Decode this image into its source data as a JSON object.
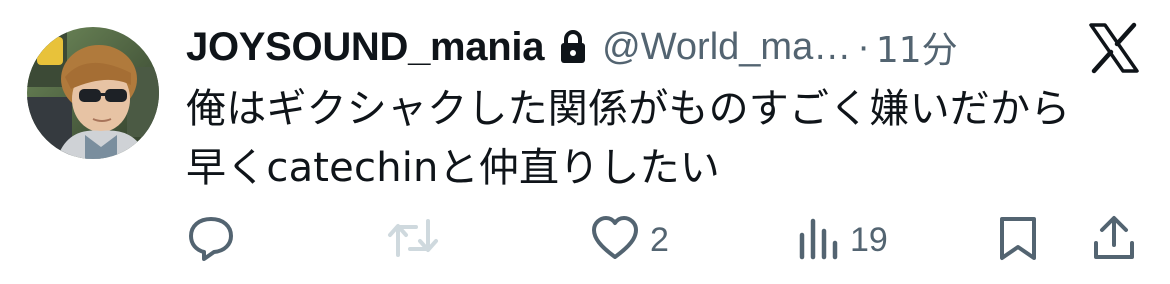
{
  "user": {
    "display_name": "JOYSOUND_mania",
    "handle": "@World_ma…",
    "separator": "·",
    "time": "11分"
  },
  "tweet": {
    "lines": [
      "俺はギクシャクした関係がものすごく嫌いだから",
      "早くcatechinと仲直りしたい"
    ]
  },
  "actions": {
    "reply_count": "",
    "retweet_count": "",
    "like_count": "2",
    "views_count": "19"
  },
  "icons": {
    "avatar": "avatar",
    "lock": "lock-icon",
    "x_logo": "x-logo-icon",
    "reply": "reply-icon",
    "retweet": "retweet-icon",
    "like": "heart-icon",
    "views": "views-icon",
    "bookmark": "bookmark-icon",
    "share": "share-icon"
  },
  "colors": {
    "text": "#0f1419",
    "secondary": "#536471",
    "retweet_disabled": "#cfd9de"
  }
}
